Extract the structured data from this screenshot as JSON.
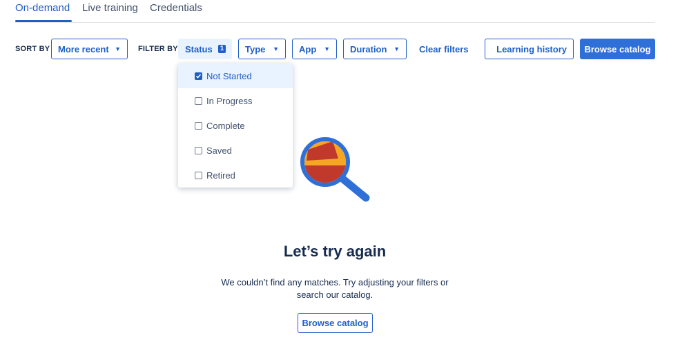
{
  "tabs": [
    {
      "label": "On-demand"
    },
    {
      "label": "Live training"
    },
    {
      "label": "Credentials"
    }
  ],
  "toolbar": {
    "sort_label": "SORT BY",
    "sort_value": "More recent",
    "filter_label": "FILTER BY",
    "status_label": "Status",
    "status_count": "1",
    "type_label": "Type",
    "app_label": "App",
    "duration_label": "Duration",
    "clear_filters": "Clear filters",
    "learning_history": "Learning history",
    "browse_catalog": "Browse catalog"
  },
  "status_options": [
    {
      "label": "Not Started",
      "checked": true
    },
    {
      "label": "In Progress",
      "checked": false
    },
    {
      "label": "Complete",
      "checked": false
    },
    {
      "label": "Saved",
      "checked": false
    },
    {
      "label": "Retired",
      "checked": false
    }
  ],
  "empty_state": {
    "title": "Let’s try again",
    "message_line1": "We couldn’t find any matches. Try adjusting your filters or",
    "message_line2": "search our catalog.",
    "button": "Browse catalog"
  },
  "colors": {
    "accent": "#1f5fc6",
    "primary_button": "#2f6fd8",
    "selected_bg": "#e9f2ff",
    "illus_blue": "#2f6fd8",
    "illus_orange": "#f5a623",
    "illus_red": "#c0392b"
  }
}
